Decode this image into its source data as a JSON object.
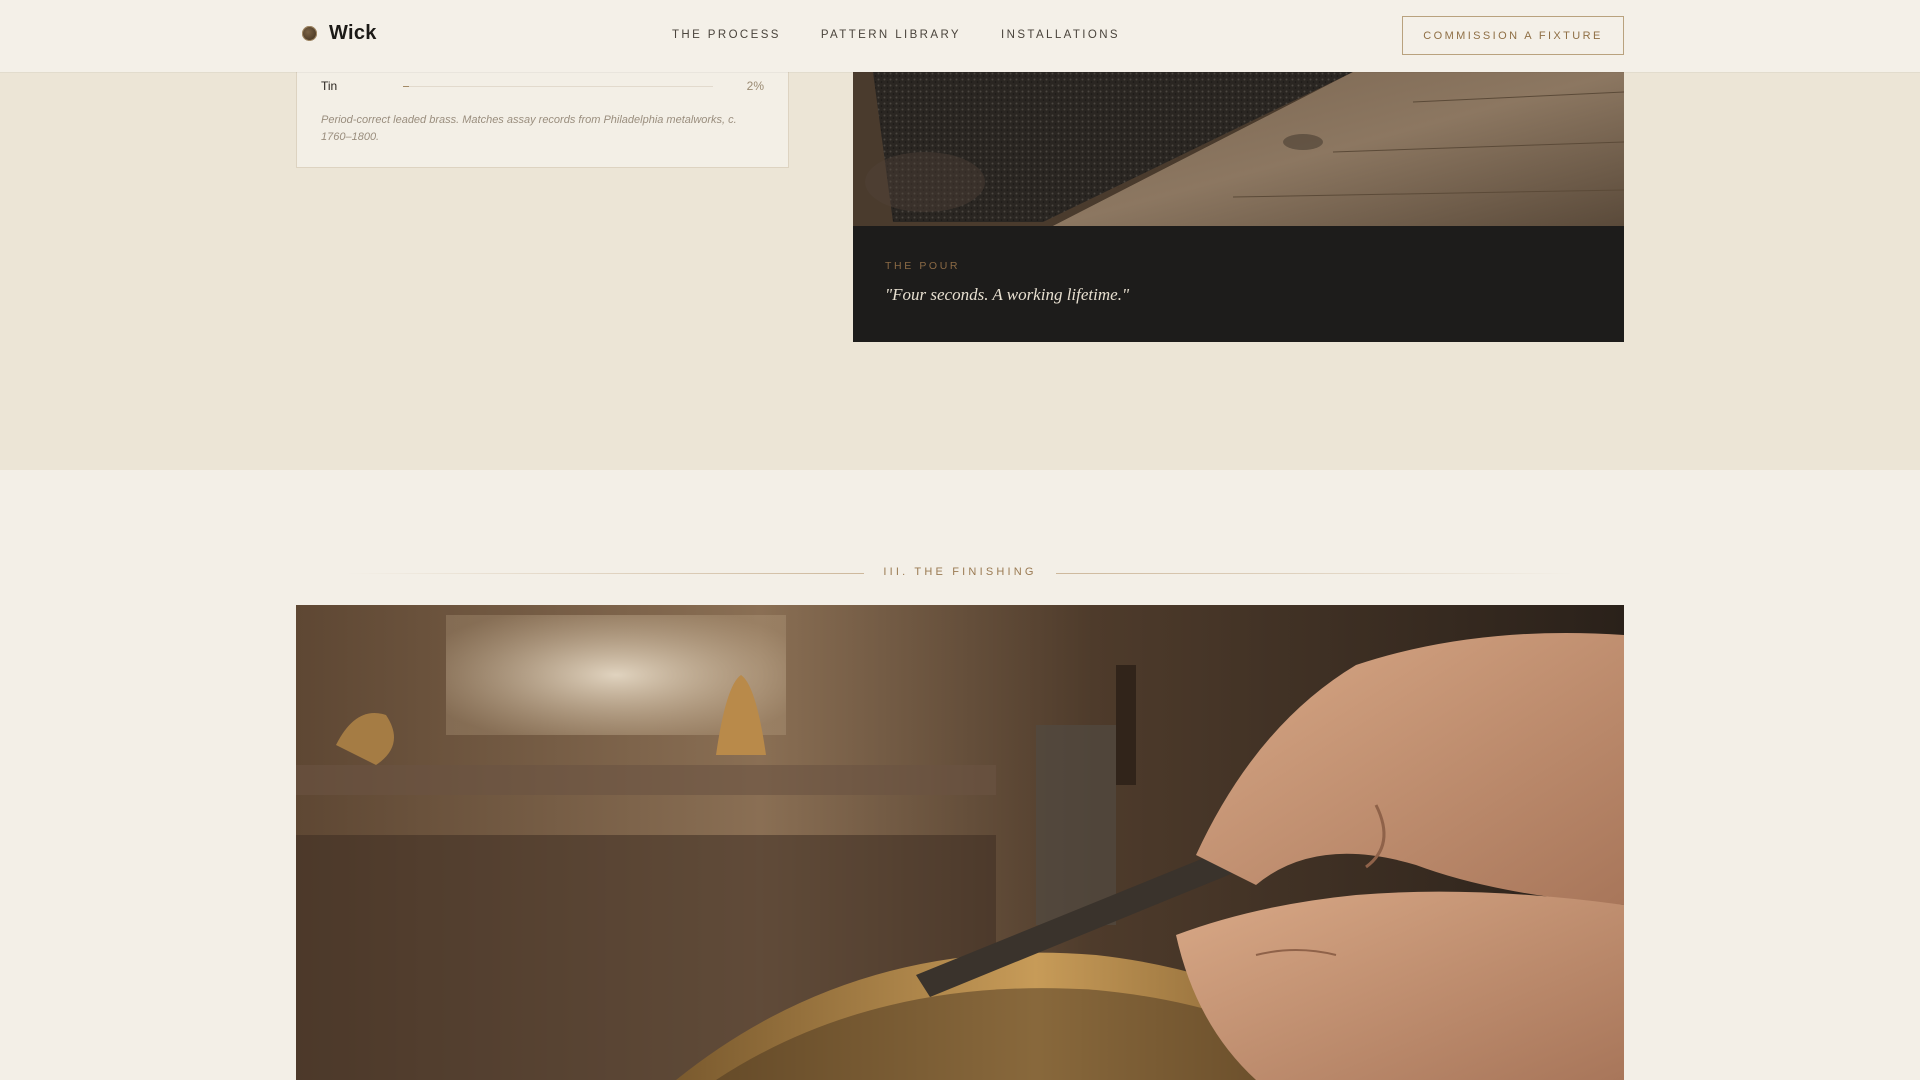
{
  "header": {
    "brand": "Wick",
    "nav": [
      "THE PROCESS",
      "PATTERN LIBRARY",
      "INSTALLATIONS"
    ],
    "cta": "COMMISSION A FIXTURE"
  },
  "alloy_card": {
    "row": {
      "label": "Tin",
      "value": "2%",
      "fill_percent": 2
    },
    "note": "Period-correct leaded brass. Matches assay records from Philadelphia metalworks, c. 1760–1800."
  },
  "pour": {
    "kicker": "THE POUR",
    "quote": "\"Four seconds. A working lifetime.\""
  },
  "finishing": {
    "section_title": "III. THE FINISHING"
  },
  "colors": {
    "accent": "#8f6f45",
    "band": "#ece5d6",
    "page": "#f3efe7",
    "caption_bg": "#1d1c1b"
  }
}
